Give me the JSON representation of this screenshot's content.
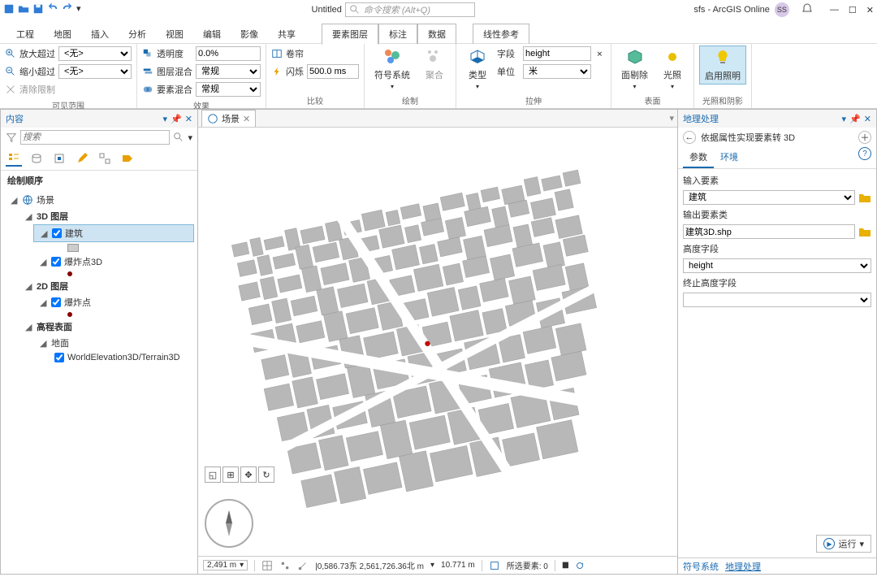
{
  "title": "Untitled",
  "searchPlaceholder": "命令搜索 (Alt+Q)",
  "account": "sfs - ArcGIS Online",
  "accountBadge": "SS",
  "tabs": {
    "project": "工程",
    "map": "地图",
    "insert": "插入",
    "analysis": "分析",
    "view": "视图",
    "edit": "编辑",
    "imagery": "影像",
    "share": "共享",
    "featureLayer": "要素图层",
    "label": "标注",
    "data": "数据",
    "linear": "线性参考"
  },
  "ribbon": {
    "range": {
      "zoomIn": "放大超过",
      "zoomOut": "缩小超过",
      "clear": "清除限制",
      "none": "<无>",
      "label": "可见范围"
    },
    "effect": {
      "trans": "透明度",
      "transVal": "0.0%",
      "layerBlend": "图层混合",
      "featBlend": "要素混合",
      "normal": "常规",
      "label": "效果"
    },
    "compare": {
      "swipe": "卷帘",
      "flash": "闪烁",
      "flashVal": "500.0 ms",
      "label": "比较"
    },
    "draw": {
      "symbol": "符号系统",
      "agg": "聚合",
      "label": "绘制"
    },
    "extrude": {
      "type": "类型",
      "field": "字段",
      "fieldVal": "height",
      "unit": "单位",
      "unitVal": "米",
      "label": "拉伸"
    },
    "face": {
      "cull": "面剔除",
      "light": "光照",
      "label": "表面"
    },
    "illum": {
      "enable": "启用照明",
      "label": "光照和阴影"
    }
  },
  "toc": {
    "title": "内容",
    "search": "搜索",
    "order": "绘制顺序",
    "scene": "场景",
    "layers3d": "3D 图层",
    "buildings": "建筑",
    "explode3d": "爆炸点3D",
    "layers2d": "2D 图层",
    "explode": "爆炸点",
    "surface": "高程表面",
    "ground": "地面",
    "terrain": "WorldElevation3D/Terrain3D"
  },
  "view": {
    "tab": "场景"
  },
  "status": {
    "scale": "2,491 m",
    "coords": "|0,586.73东 2,561,726.36北 m",
    "elev": "10.771 m",
    "sel": "所选要素: 0"
  },
  "gp": {
    "title": "地理处理",
    "tool": "依据属性实现要素转 3D",
    "params": "参数",
    "env": "环境",
    "inFeat": "输入要素",
    "inFeatVal": "建筑",
    "outFC": "输出要素类",
    "outFCVal": "建筑3D.shp",
    "hField": "高度字段",
    "hFieldVal": "height",
    "toHField": "终止高度字段",
    "run": "运行",
    "footSymbol": "符号系统",
    "footGP": "地理处理"
  }
}
